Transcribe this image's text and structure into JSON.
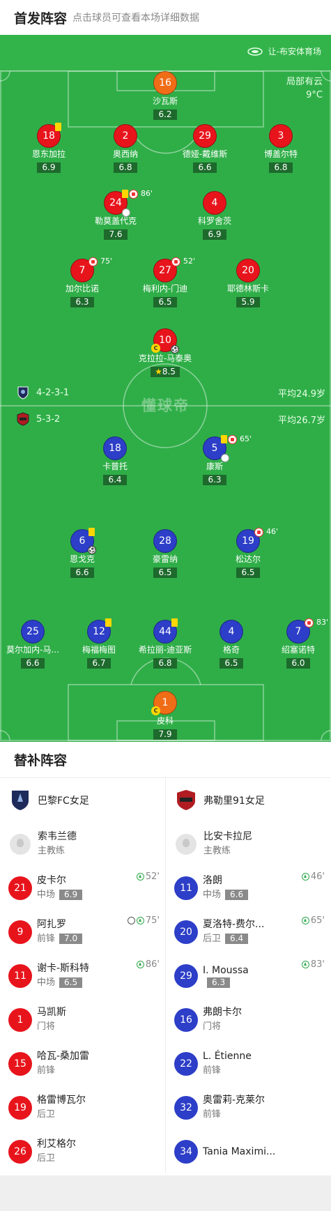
{
  "header": {
    "title": "首发阵容",
    "subtitle": "点击球员可查看本场详细数据"
  },
  "venue": {
    "name": "让-布安体育场",
    "icon": "stadium-icon"
  },
  "weather": {
    "condition": "局部有云",
    "temp": "9°C"
  },
  "watermark": "懂球帝",
  "home_form": {
    "formation": "4-2-3-1",
    "avg_age": "平均24.9岁"
  },
  "away_form": {
    "formation": "5-3-2",
    "avg_age": "平均26.7岁"
  },
  "colors": {
    "red": "#e8141c",
    "blue": "#2d3ec8",
    "orange": "#f06d18",
    "pitch": "#2fae48"
  },
  "red_players": [
    {
      "num": "16",
      "name": "沙瓦斯",
      "rating": "6.2",
      "gk": true
    },
    {
      "num": "18",
      "name": "恩东加拉",
      "rating": "6.9",
      "yellow": true
    },
    {
      "num": "2",
      "name": "奥西纳",
      "rating": "6.8"
    },
    {
      "num": "29",
      "name": "德娅-戴维斯",
      "rating": "6.6"
    },
    {
      "num": "3",
      "name": "博盖尔特",
      "rating": "6.8"
    },
    {
      "num": "24",
      "name": "勒莫盖代克",
      "rating": "7.6",
      "yellow": true,
      "sub": "86'"
    },
    {
      "num": "4",
      "name": "科罗舍茨",
      "rating": "6.9"
    },
    {
      "num": "7",
      "name": "加尔比诺",
      "rating": "6.3",
      "sub": "75'"
    },
    {
      "num": "27",
      "name": "梅利内-门迪",
      "rating": "6.5",
      "sub": "52'"
    },
    {
      "num": "20",
      "name": "耶德林斯卡",
      "rating": "5.9"
    },
    {
      "num": "10",
      "name": "克拉拉-马泰奥",
      "rating": "8.5",
      "captain": true,
      "mvp": true
    }
  ],
  "blue_players": [
    {
      "num": "18",
      "name": "卡普托",
      "rating": "6.4"
    },
    {
      "num": "5",
      "name": "康斯",
      "rating": "6.3",
      "yellow": true,
      "sub": "65'"
    },
    {
      "num": "6",
      "name": "恩戈克",
      "rating": "6.6",
      "yellow": true
    },
    {
      "num": "28",
      "name": "豪雷纳",
      "rating": "6.5"
    },
    {
      "num": "19",
      "name": "松达尔",
      "rating": "6.5",
      "sub": "46'"
    },
    {
      "num": "25",
      "name": "莫尔加内-马...",
      "rating": "6.6"
    },
    {
      "num": "12",
      "name": "梅福梅图",
      "rating": "6.7",
      "yellow": true
    },
    {
      "num": "44",
      "name": "希拉丽-迪亚斯",
      "rating": "6.8",
      "yellow": true
    },
    {
      "num": "4",
      "name": "格奇",
      "rating": "6.5"
    },
    {
      "num": "7",
      "name": "绍塞诺特",
      "rating": "6.0",
      "sub": "83'"
    },
    {
      "num": "1",
      "name": "皮科",
      "rating": "7.9",
      "captain": true,
      "gk": true
    }
  ],
  "subs": {
    "title": "替补阵容",
    "left": {
      "team": "巴黎FC女足",
      "coach": {
        "name": "索韦兰德",
        "role": "主教练"
      },
      "players": [
        {
          "num": "21",
          "name": "皮卡尔",
          "pos": "中场",
          "rating": "6.9",
          "time": "52'"
        },
        {
          "num": "9",
          "name": "阿扎罗",
          "pos": "前锋",
          "rating": "7.0",
          "time": "75'",
          "goal": true
        },
        {
          "num": "11",
          "name": "谢卡-斯科特",
          "pos": "中场",
          "rating": "6.5",
          "time": "86'"
        },
        {
          "num": "1",
          "name": "马凯斯",
          "pos": "门将"
        },
        {
          "num": "15",
          "name": "哈瓦-桑加雷",
          "pos": "前锋"
        },
        {
          "num": "19",
          "name": "格雷博瓦尔",
          "pos": "后卫"
        },
        {
          "num": "26",
          "name": "利艾格尔",
          "pos": "后卫"
        }
      ]
    },
    "right": {
      "team": "弗勒里91女足",
      "coach": {
        "name": "比安卡拉尼",
        "role": "主教练"
      },
      "players": [
        {
          "num": "11",
          "name": "洛朗",
          "pos": "中场",
          "rating": "6.6",
          "time": "46'"
        },
        {
          "num": "20",
          "name": "夏洛特-费尔...",
          "pos": "后卫",
          "rating": "6.4",
          "time": "65'"
        },
        {
          "num": "29",
          "name": "I. Moussa",
          "pos": "",
          "rating": "6.3",
          "time": "83'"
        },
        {
          "num": "16",
          "name": "弗朗卡尔",
          "pos": "门将"
        },
        {
          "num": "22",
          "name": "L. Étienne",
          "pos": "前锋"
        },
        {
          "num": "32",
          "name": "奥雷莉-克莱尔",
          "pos": "前锋"
        },
        {
          "num": "34",
          "name": "Tania Maximi...",
          "pos": ""
        }
      ]
    }
  }
}
